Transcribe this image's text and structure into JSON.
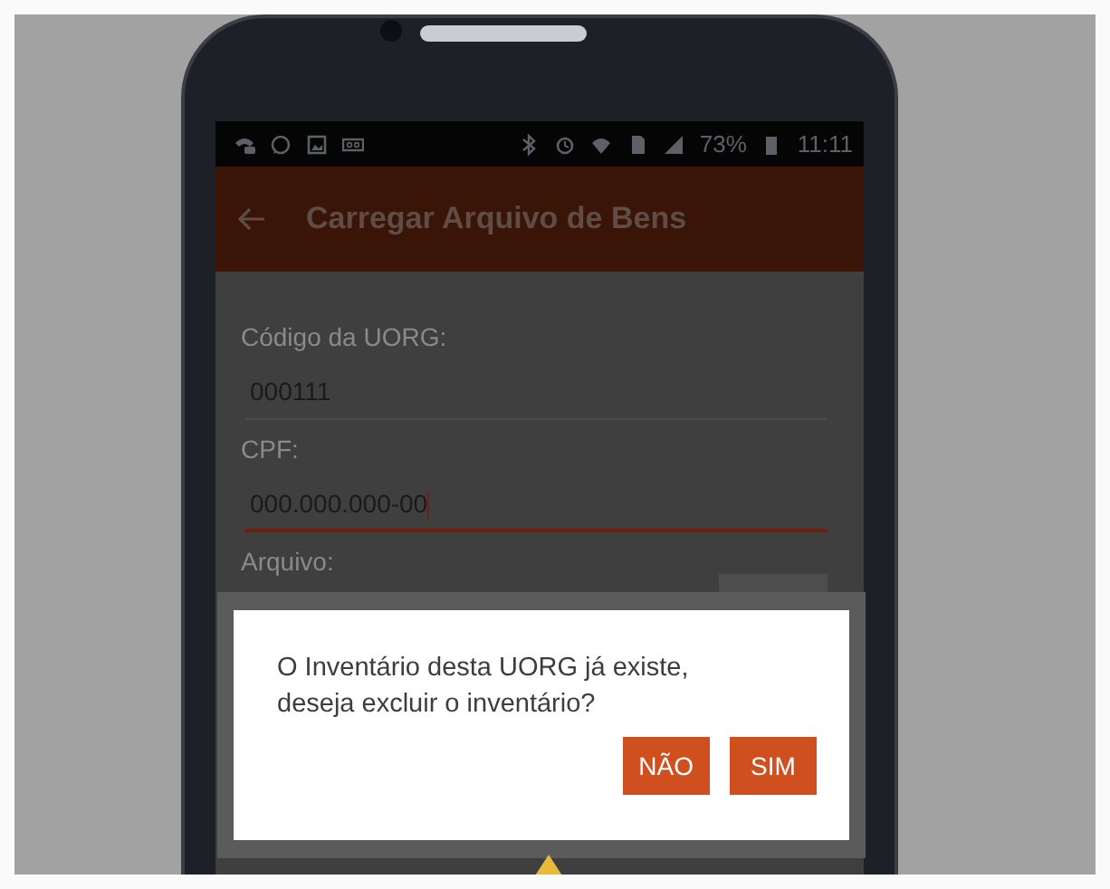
{
  "status_bar": {
    "battery": "73%",
    "time": "11:11"
  },
  "app_bar": {
    "title": "Carregar Arquivo de Bens"
  },
  "form": {
    "fields": [
      {
        "label": "Código da UORG:",
        "value": "000111",
        "focused": false
      },
      {
        "label": "CPF:",
        "value": "000.000.000-00",
        "focused": true
      }
    ],
    "file_label": "Arquivo:"
  },
  "dialog": {
    "message": "O Inventário desta UORG já existe, deseja excluir o inventário?",
    "buttons": [
      {
        "label": "NÃO"
      },
      {
        "label": "SIM"
      }
    ]
  }
}
